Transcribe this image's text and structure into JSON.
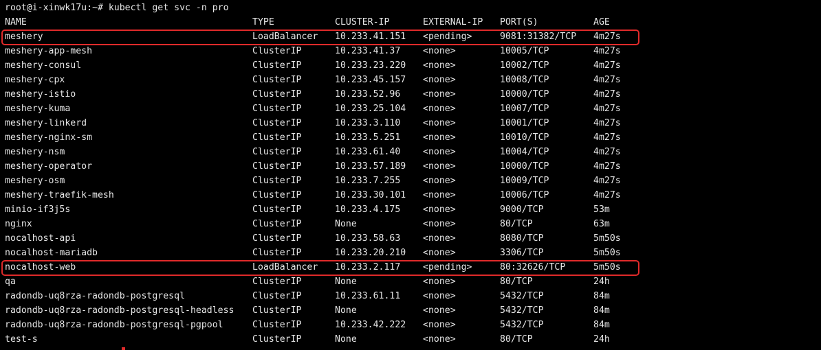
{
  "terminal": {
    "prompt": "root@i-xinwk17u:~# kubectl get svc -n pro",
    "accent_color": "#e02a2a",
    "headers": {
      "name": "NAME",
      "type": "TYPE",
      "cluster_ip": "CLUSTER-IP",
      "external_ip": "EXTERNAL-IP",
      "ports": "PORT(S)",
      "age": "AGE"
    },
    "rows": [
      {
        "name": "meshery",
        "type": "LoadBalancer",
        "cluster_ip": "10.233.41.151",
        "external_ip": "<pending>",
        "ports": "9081:31382/TCP",
        "age": "4m27s"
      },
      {
        "name": "meshery-app-mesh",
        "type": "ClusterIP",
        "cluster_ip": "10.233.41.37",
        "external_ip": "<none>",
        "ports": "10005/TCP",
        "age": "4m27s"
      },
      {
        "name": "meshery-consul",
        "type": "ClusterIP",
        "cluster_ip": "10.233.23.220",
        "external_ip": "<none>",
        "ports": "10002/TCP",
        "age": "4m27s"
      },
      {
        "name": "meshery-cpx",
        "type": "ClusterIP",
        "cluster_ip": "10.233.45.157",
        "external_ip": "<none>",
        "ports": "10008/TCP",
        "age": "4m27s"
      },
      {
        "name": "meshery-istio",
        "type": "ClusterIP",
        "cluster_ip": "10.233.52.96",
        "external_ip": "<none>",
        "ports": "10000/TCP",
        "age": "4m27s"
      },
      {
        "name": "meshery-kuma",
        "type": "ClusterIP",
        "cluster_ip": "10.233.25.104",
        "external_ip": "<none>",
        "ports": "10007/TCP",
        "age": "4m27s"
      },
      {
        "name": "meshery-linkerd",
        "type": "ClusterIP",
        "cluster_ip": "10.233.3.110",
        "external_ip": "<none>",
        "ports": "10001/TCP",
        "age": "4m27s"
      },
      {
        "name": "meshery-nginx-sm",
        "type": "ClusterIP",
        "cluster_ip": "10.233.5.251",
        "external_ip": "<none>",
        "ports": "10010/TCP",
        "age": "4m27s"
      },
      {
        "name": "meshery-nsm",
        "type": "ClusterIP",
        "cluster_ip": "10.233.61.40",
        "external_ip": "<none>",
        "ports": "10004/TCP",
        "age": "4m27s"
      },
      {
        "name": "meshery-operator",
        "type": "ClusterIP",
        "cluster_ip": "10.233.57.189",
        "external_ip": "<none>",
        "ports": "10000/TCP",
        "age": "4m27s"
      },
      {
        "name": "meshery-osm",
        "type": "ClusterIP",
        "cluster_ip": "10.233.7.255",
        "external_ip": "<none>",
        "ports": "10009/TCP",
        "age": "4m27s"
      },
      {
        "name": "meshery-traefik-mesh",
        "type": "ClusterIP",
        "cluster_ip": "10.233.30.101",
        "external_ip": "<none>",
        "ports": "10006/TCP",
        "age": "4m27s"
      },
      {
        "name": "minio-if3j5s",
        "type": "ClusterIP",
        "cluster_ip": "10.233.4.175",
        "external_ip": "<none>",
        "ports": "9000/TCP",
        "age": "53m"
      },
      {
        "name": "nginx",
        "type": "ClusterIP",
        "cluster_ip": "None",
        "external_ip": "<none>",
        "ports": "80/TCP",
        "age": "63m"
      },
      {
        "name": "nocalhost-api",
        "type": "ClusterIP",
        "cluster_ip": "10.233.58.63",
        "external_ip": "<none>",
        "ports": "8080/TCP",
        "age": "5m50s"
      },
      {
        "name": "nocalhost-mariadb",
        "type": "ClusterIP",
        "cluster_ip": "10.233.20.210",
        "external_ip": "<none>",
        "ports": "3306/TCP",
        "age": "5m50s"
      },
      {
        "name": "nocalhost-web",
        "type": "LoadBalancer",
        "cluster_ip": "10.233.2.117",
        "external_ip": "<pending>",
        "ports": "80:32626/TCP",
        "age": "5m50s"
      },
      {
        "name": "qa",
        "type": "ClusterIP",
        "cluster_ip": "None",
        "external_ip": "<none>",
        "ports": "80/TCP",
        "age": "24h"
      },
      {
        "name": "radondb-uq8rza-radondb-postgresql",
        "type": "ClusterIP",
        "cluster_ip": "10.233.61.11",
        "external_ip": "<none>",
        "ports": "5432/TCP",
        "age": "84m"
      },
      {
        "name": "radondb-uq8rza-radondb-postgresql-headless",
        "type": "ClusterIP",
        "cluster_ip": "None",
        "external_ip": "<none>",
        "ports": "5432/TCP",
        "age": "84m"
      },
      {
        "name": "radondb-uq8rza-radondb-postgresql-pgpool",
        "type": "ClusterIP",
        "cluster_ip": "10.233.42.222",
        "external_ip": "<none>",
        "ports": "5432/TCP",
        "age": "84m"
      },
      {
        "name": "test-s",
        "type": "ClusterIP",
        "cluster_ip": "None",
        "external_ip": "<none>",
        "ports": "80/TCP",
        "age": "24h"
      }
    ]
  }
}
